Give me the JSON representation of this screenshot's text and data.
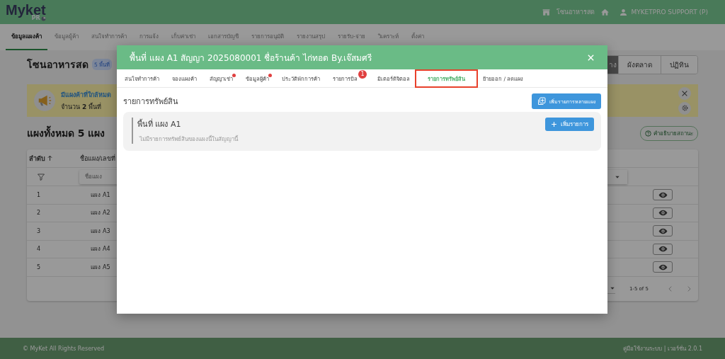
{
  "header": {
    "logo": "Myket",
    "logo_sub": "PR",
    "market": "โซนอาหารสด",
    "user": "MYKETPRO SUPPORT (P)"
  },
  "nav_tabs": [
    {
      "label": "ข้อมูลแผงค้า",
      "selected": true
    },
    {
      "label": "ข้อมูลผู้ค้า",
      "selected": false
    },
    {
      "label": "สนใจทำการค้า",
      "selected": false
    },
    {
      "label": "การแจ้ง",
      "selected": false
    },
    {
      "label": "เก็บค่าเช่า",
      "selected": false
    },
    {
      "label": "เอกสารบัญชี",
      "selected": false
    },
    {
      "label": "รายการอนุมัติ",
      "selected": false
    },
    {
      "label": "รายงานสรุป",
      "selected": false
    },
    {
      "label": "รายรับ-จ่าย",
      "selected": false
    },
    {
      "label": "วิเคราะห์",
      "selected": false
    },
    {
      "label": "ตั้งค่า",
      "selected": false
    }
  ],
  "page": {
    "title": "โซนอาหารสด",
    "badge": "5 พื้นที่",
    "view_toggle": [
      {
        "label": "าง",
        "selected": true
      },
      {
        "label": "ผังตลาด",
        "selected": false
      },
      {
        "label": "ปฏิทิน",
        "selected": false
      }
    ]
  },
  "alert": {
    "title": "มีแผงค้าที่ใกล้หมด",
    "text": "จำนวน **2** พื้นที่"
  },
  "section": {
    "title": "แผงทั้งหมด 5 แผง",
    "help_button": "คำอธิบายสถานะ"
  },
  "table": {
    "columns": [
      "ลำดับ",
      "ชื่อแผง/เลขที่"
    ],
    "filter_placeholder": "ชื่อแผง",
    "rows": [
      {
        "no": "1",
        "name": "แผง A1"
      },
      {
        "no": "2",
        "name": "แผง A2"
      },
      {
        "no": "3",
        "name": "แผง A3"
      },
      {
        "no": "4",
        "name": "แผง A4"
      },
      {
        "no": "5",
        "name": "แผง A5"
      }
    ],
    "pagination": "1-5 of 5"
  },
  "footer": {
    "copyright": "© MyKet All Rights Reserved",
    "links": "คู่มือใช้งานระบบ | เวอร์ชั่น 2.0.1"
  },
  "modal": {
    "title": "พื้นที่ แผง A1 สัญญา 2025080001 ชื่อร้านค้า ไก่ทอด By.เจ๊สมศรี",
    "tabs": [
      {
        "label": "สนใจทำการค้า",
        "selected": false,
        "dot": false,
        "highlighted": false
      },
      {
        "label": "จองแผงค้า",
        "selected": false,
        "dot": false,
        "highlighted": false
      },
      {
        "label": "สัญญาเช่า",
        "selected": false,
        "dot": true,
        "highlighted": false
      },
      {
        "label": "ข้อมูลผู้ค้า",
        "selected": false,
        "dot": true,
        "highlighted": false
      },
      {
        "label": "ประวัติพักการค้า",
        "selected": false,
        "dot": false,
        "highlighted": false
      },
      {
        "label": "รายการบิล",
        "selected": false,
        "dot": false,
        "badge": "1",
        "highlighted": false
      },
      {
        "label": "มิเตอร์ดิจิตอล",
        "selected": false,
        "dot": false,
        "highlighted": false
      },
      {
        "label": "รายการทรัพย์สิน",
        "selected": true,
        "dot": false,
        "highlighted": true
      },
      {
        "label": "ย้ายออก / ลดแผง",
        "selected": false,
        "dot": false,
        "highlighted": false
      }
    ],
    "section_title": "รายการทรัพย์สิน",
    "add_multi_button": "เพิ่มรายการหลายแผง",
    "card": {
      "title": "พื้นที่ แผง A1",
      "empty_text": "ไม่มีรายการทรัพย์สินของแผงนี้ในสัญญานี้",
      "add_button": "เพิ่มรายการ"
    }
  }
}
